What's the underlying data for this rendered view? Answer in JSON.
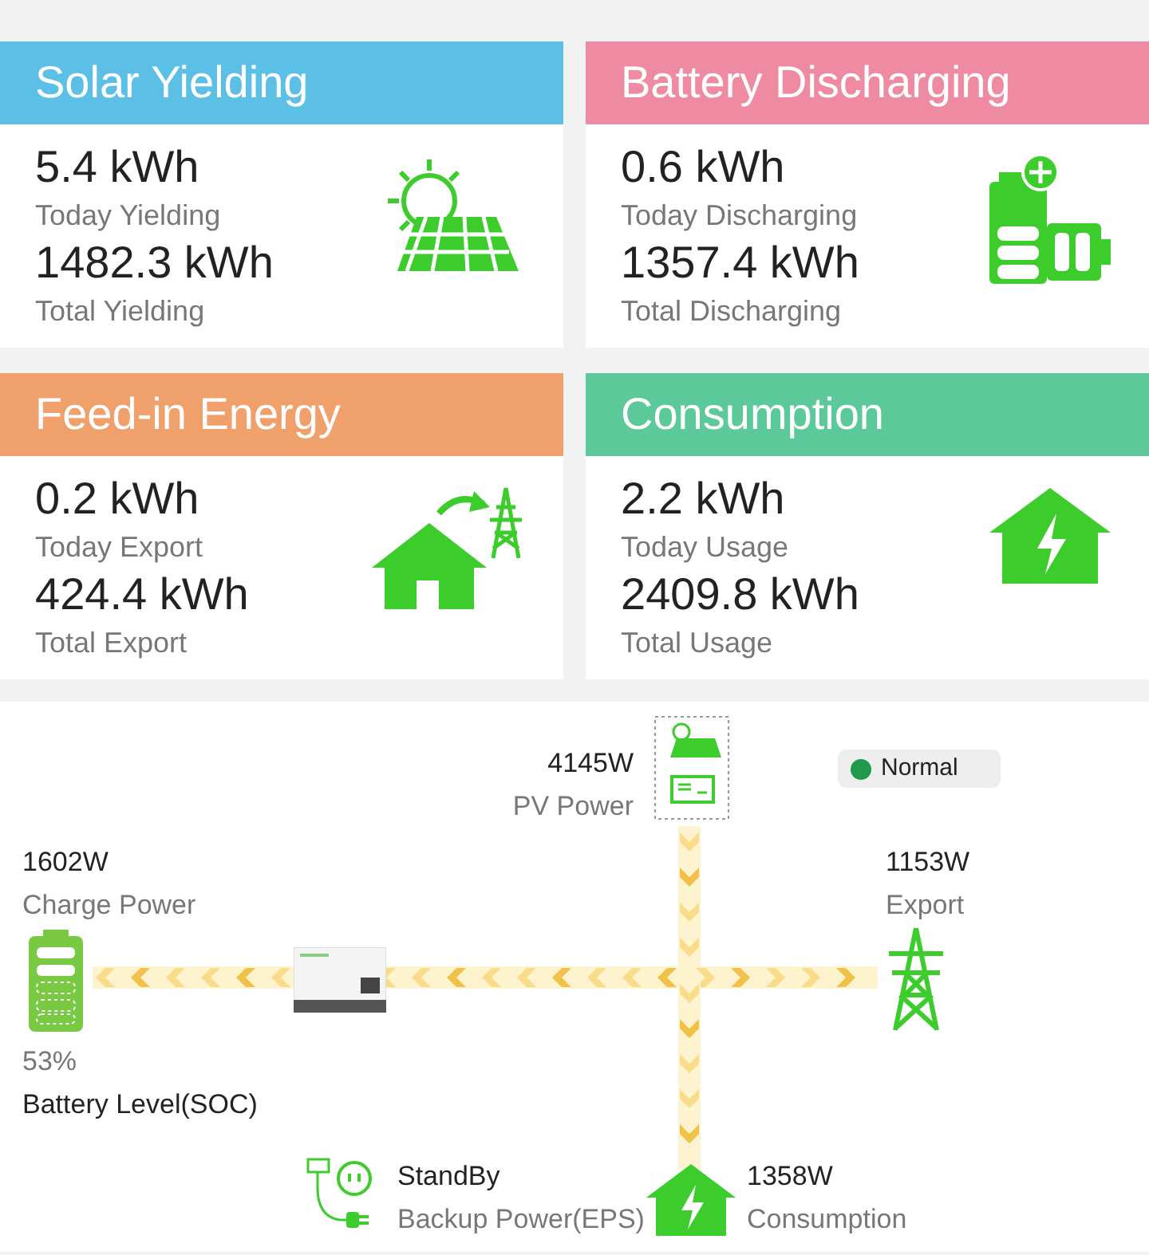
{
  "cards": [
    {
      "kind": "solar",
      "title": "Solar Yielding",
      "color": "#5bbfe6",
      "today_value": "5.4 kWh",
      "today_label": "Today Yielding",
      "total_value": "1482.3 kWh",
      "total_label": "Total Yielding"
    },
    {
      "kind": "battery",
      "title": "Battery Discharging",
      "color": "#ee8ba3",
      "today_value": "0.6 kWh",
      "today_label": "Today Discharging",
      "total_value": "1357.4 kWh",
      "total_label": "Total Discharging"
    },
    {
      "kind": "feedin",
      "title": "Feed-in Energy",
      "color": "#f0a06a",
      "today_value": "0.2 kWh",
      "today_label": "Today Export",
      "total_value": "424.4 kWh",
      "total_label": "Total Export"
    },
    {
      "kind": "consumption",
      "title": "Consumption",
      "color": "#5bc99a",
      "today_value": "2.2 kWh",
      "today_label": "Today Usage",
      "total_value": "2409.8 kWh",
      "total_label": "Total Usage"
    }
  ],
  "diagram": {
    "pv": {
      "value": "4145W",
      "label": "PV Power"
    },
    "status": {
      "label": "Normal",
      "color": "#1e9a4a"
    },
    "battery": {
      "value": "1602W",
      "label": "Charge Power",
      "percent": "53%",
      "soc_label": "Battery Level(SOC)"
    },
    "grid": {
      "value": "1153W",
      "label": "Export"
    },
    "eps": {
      "value": "StandBy",
      "label": "Backup Power(EPS)"
    },
    "load": {
      "value": "1358W",
      "label": "Consumption"
    },
    "flows": [
      {
        "kind": "pv"
      },
      {
        "kind": "battery"
      },
      {
        "kind": "grid"
      },
      {
        "kind": "load"
      }
    ]
  }
}
